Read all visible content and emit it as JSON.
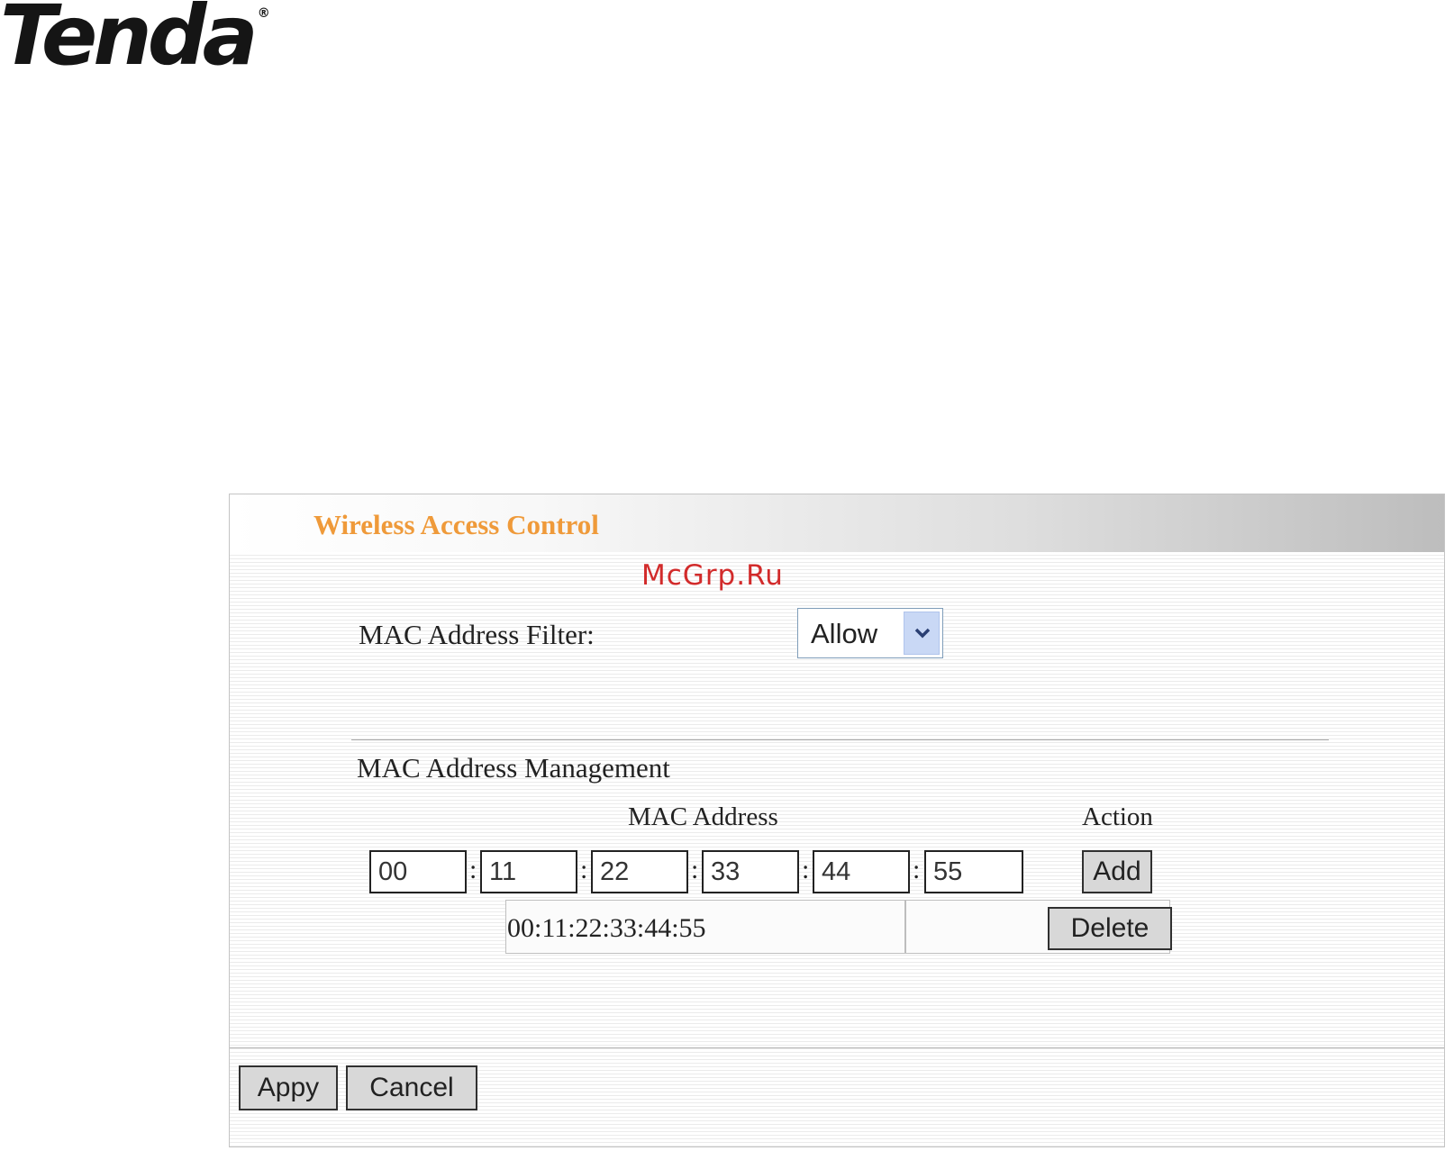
{
  "brand": {
    "logo_text": "Tenda",
    "registered_mark": "®"
  },
  "watermark": "McGrp.Ru",
  "panel": {
    "title": "Wireless Access Control",
    "mac_filter_label": "MAC Address Filter:",
    "mac_filter_selected": "Allow",
    "management_label": "MAC Address Management",
    "col_mac_address": "MAC Address",
    "col_action": "Action",
    "mac_inputs": [
      "00",
      "11",
      "22",
      "33",
      "44",
      "55"
    ],
    "separator": ":",
    "add_label": "Add",
    "entries": [
      {
        "mac": "00:11:22:33:44:55",
        "delete_label": "Delete"
      }
    ],
    "apply_label": "Appy",
    "cancel_label": "Cancel"
  },
  "colors": {
    "title": "#ef9a3a",
    "watermark": "#d22b2b"
  }
}
